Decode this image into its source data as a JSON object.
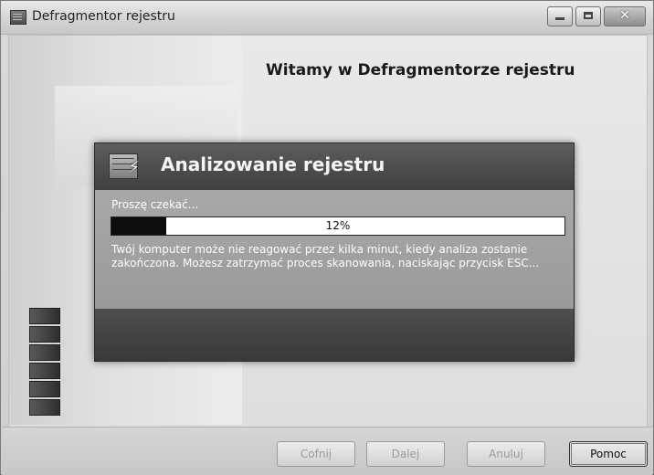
{
  "window": {
    "title": "Defragmentor rejestru",
    "controls": {
      "minimize": "minimize",
      "maximize": "maximize",
      "close": "✕"
    }
  },
  "welcome": {
    "heading": "Witamy w Defragmentorze rejestru"
  },
  "dialog": {
    "title": "Analizowanie rejestru",
    "wait_text": "Proszę czekać...",
    "progress_value": 0.12,
    "progress_label": "12%",
    "info_text": "Twój komputer może nie reagować przez kilka minut, kiedy analiza zostanie zakończona. Możesz zatrzymać proces skanowania, naciskając przycisk ESC..."
  },
  "buttons": {
    "back": "Cofnij",
    "next": "Dalej",
    "cancel": "Anuluj",
    "help": "Pomoc"
  },
  "icons": {
    "app": "registry-app-icon",
    "dialog": "registry-lightning-icon"
  }
}
